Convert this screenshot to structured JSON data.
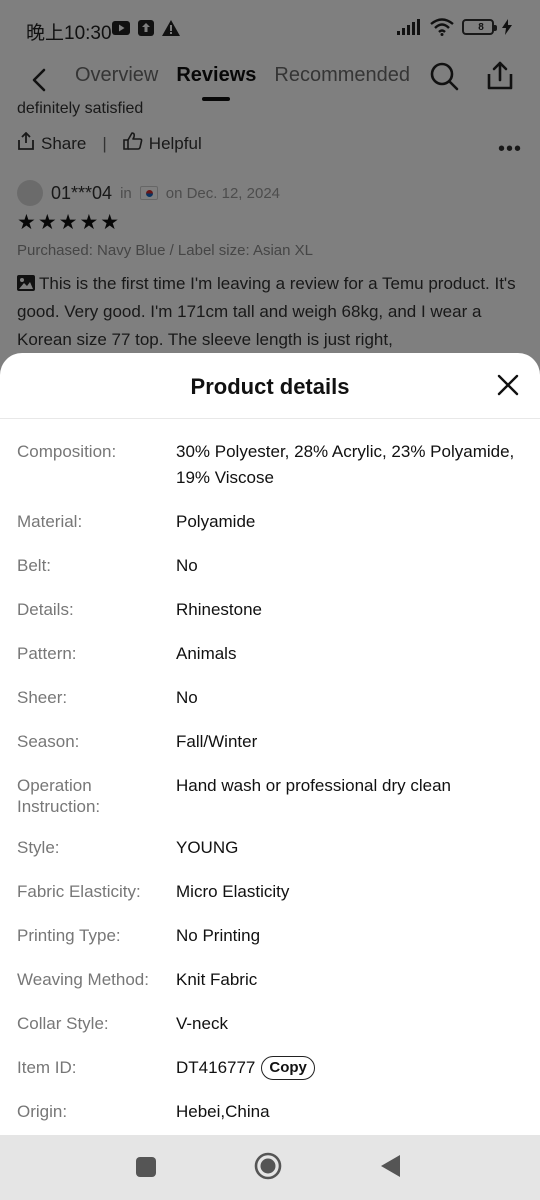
{
  "status": {
    "time": "晚上10:30",
    "battery": "8",
    "icons": [
      "youtube-icon",
      "upload-icon",
      "alert-icon",
      "signal-icon",
      "wifi-icon",
      "battery-icon",
      "charging-icon"
    ]
  },
  "nav": {
    "tabs": [
      {
        "label": "Overview",
        "active": false
      },
      {
        "label": "Reviews",
        "active": true
      },
      {
        "label": "Recommended",
        "active": false
      }
    ]
  },
  "review": {
    "prev_text": "definitely satisfied",
    "share_label": "Share",
    "separator": "|",
    "helpful_label": "Helpful",
    "reviewer": "01***04",
    "in_label": "in",
    "date": "on Dec. 12, 2024",
    "stars": "★★★★★",
    "rating": 5,
    "purchased": "Purchased: Navy Blue / Label size: Asian XL",
    "body": "This is the first time I'm leaving a review for a Temu product. It's good. Very good. I'm 171cm tall and weigh 68kg, and I wear a Korean size 77 top. The sleeve length is just right,"
  },
  "sheet": {
    "title": "Product details",
    "copy_label": "Copy",
    "details": [
      {
        "label": "Composition:",
        "value": "30% Polyester, 28% Acrylic, 23% Polyamide, 19% Viscose"
      },
      {
        "label": "Material:",
        "value": "Polyamide"
      },
      {
        "label": "Belt:",
        "value": "No"
      },
      {
        "label": "Details:",
        "value": "Rhinestone"
      },
      {
        "label": "Pattern:",
        "value": "Animals"
      },
      {
        "label": "Sheer:",
        "value": "No"
      },
      {
        "label": "Season:",
        "value": "Fall/Winter"
      },
      {
        "label": "Operation Instruction:",
        "value": "Hand wash or professional dry clean"
      },
      {
        "label": "Style:",
        "value": "YOUNG"
      },
      {
        "label": "Fabric Elasticity:",
        "value": "Micro Elasticity"
      },
      {
        "label": "Printing Type:",
        "value": "No Printing"
      },
      {
        "label": "Weaving Method:",
        "value": "Knit Fabric"
      },
      {
        "label": "Collar Style:",
        "value": "V-neck"
      },
      {
        "label": "Item ID:",
        "value": "DT416777"
      },
      {
        "label": "Origin:",
        "value": "Hebei,China"
      }
    ]
  },
  "colors": {
    "overlay": "#000000",
    "sheet_bg": "#ffffff",
    "sysnav_bg": "#e5e5e5"
  }
}
